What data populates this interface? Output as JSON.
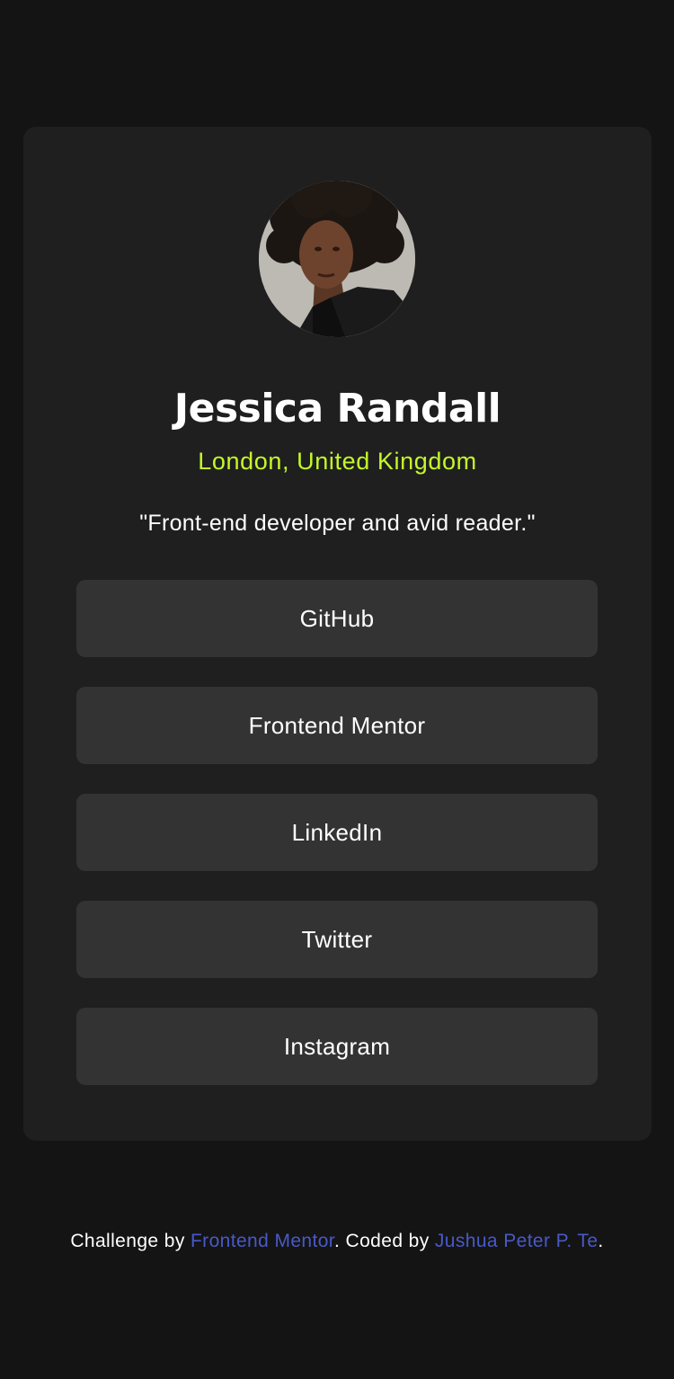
{
  "profile": {
    "name": "Jessica Randall",
    "location": "London, United Kingdom",
    "bio": "\"Front-end developer and avid reader.\""
  },
  "links": [
    {
      "label": "GitHub"
    },
    {
      "label": "Frontend Mentor"
    },
    {
      "label": "LinkedIn"
    },
    {
      "label": "Twitter"
    },
    {
      "label": "Instagram"
    }
  ],
  "footer": {
    "prefix": "Challenge by ",
    "challenge_link": "Frontend Mentor",
    "middle": ". Coded by ",
    "author_link": "Jushua Peter P. Te",
    "suffix": "."
  },
  "colors": {
    "page_background": "#141414",
    "card_background": "#1f1f1f",
    "button_background": "#333333",
    "accent_green": "#c4f82a",
    "link_blue": "#4959c8",
    "text": "#ffffff"
  }
}
